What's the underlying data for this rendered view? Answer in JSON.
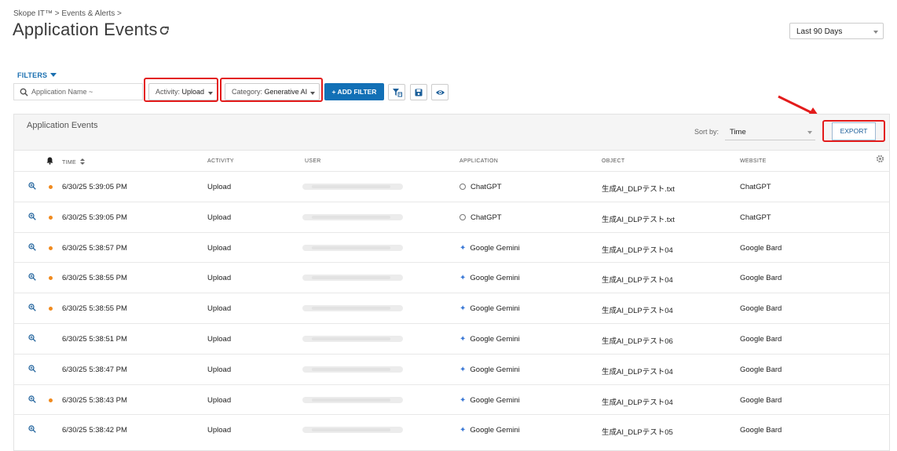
{
  "breadcrumb": "Skope IT™ > Events & Alerts >",
  "page_title": "Application Events",
  "date_range": "Last 90 Days",
  "filters": {
    "label": "FILTERS",
    "search_placeholder": "Application Name ~",
    "activity_label": "Activity:",
    "activity_value": "Upload",
    "category_label": "Category:",
    "category_value": "Generative AI",
    "add_filter_label": "+ ADD FILTER"
  },
  "panel": {
    "title": "Application Events",
    "sort_label": "Sort by:",
    "sort_value": "Time",
    "export_label": "EXPORT"
  },
  "columns": [
    "TIME",
    "ACTIVITY",
    "USER",
    "APPLICATION",
    "OBJECT",
    "WEBSITE"
  ],
  "rows": [
    {
      "alert": true,
      "time": "6/30/25 5:39:05 PM",
      "activity": "Upload",
      "app_icon": "chatgpt-icon",
      "application": "ChatGPT",
      "object": "生成AI_DLPテスト.txt",
      "website": "ChatGPT"
    },
    {
      "alert": true,
      "time": "6/30/25 5:39:05 PM",
      "activity": "Upload",
      "app_icon": "chatgpt-icon",
      "application": "ChatGPT",
      "object": "生成AI_DLPテスト.txt",
      "website": "ChatGPT"
    },
    {
      "alert": true,
      "time": "6/30/25 5:38:57 PM",
      "activity": "Upload",
      "app_icon": "gemini-icon",
      "application": "Google Gemini",
      "object": "生成AI_DLPテスト04",
      "website": "Google Bard"
    },
    {
      "alert": true,
      "time": "6/30/25 5:38:55 PM",
      "activity": "Upload",
      "app_icon": "gemini-icon",
      "application": "Google Gemini",
      "object": "生成AI_DLPテスト04",
      "website": "Google Bard"
    },
    {
      "alert": true,
      "time": "6/30/25 5:38:55 PM",
      "activity": "Upload",
      "app_icon": "gemini-icon",
      "application": "Google Gemini",
      "object": "生成AI_DLPテスト04",
      "website": "Google Bard"
    },
    {
      "alert": false,
      "time": "6/30/25 5:38:51 PM",
      "activity": "Upload",
      "app_icon": "gemini-icon",
      "application": "Google Gemini",
      "object": "生成AI_DLPテスト06",
      "website": "Google Bard"
    },
    {
      "alert": false,
      "time": "6/30/25 5:38:47 PM",
      "activity": "Upload",
      "app_icon": "gemini-icon",
      "application": "Google Gemini",
      "object": "生成AI_DLPテスト04",
      "website": "Google Bard"
    },
    {
      "alert": true,
      "time": "6/30/25 5:38:43 PM",
      "activity": "Upload",
      "app_icon": "gemini-icon",
      "application": "Google Gemini",
      "object": "生成AI_DLPテスト04",
      "website": "Google Bard"
    },
    {
      "alert": false,
      "time": "6/30/25 5:38:42 PM",
      "activity": "Upload",
      "app_icon": "gemini-icon",
      "application": "Google Gemini",
      "object": "生成AI_DLPテスト05",
      "website": "Google Bard"
    }
  ],
  "colors": {
    "accent": "#1270b6",
    "alert_dot": "#f08a1e",
    "highlight": "#e31b1b"
  }
}
